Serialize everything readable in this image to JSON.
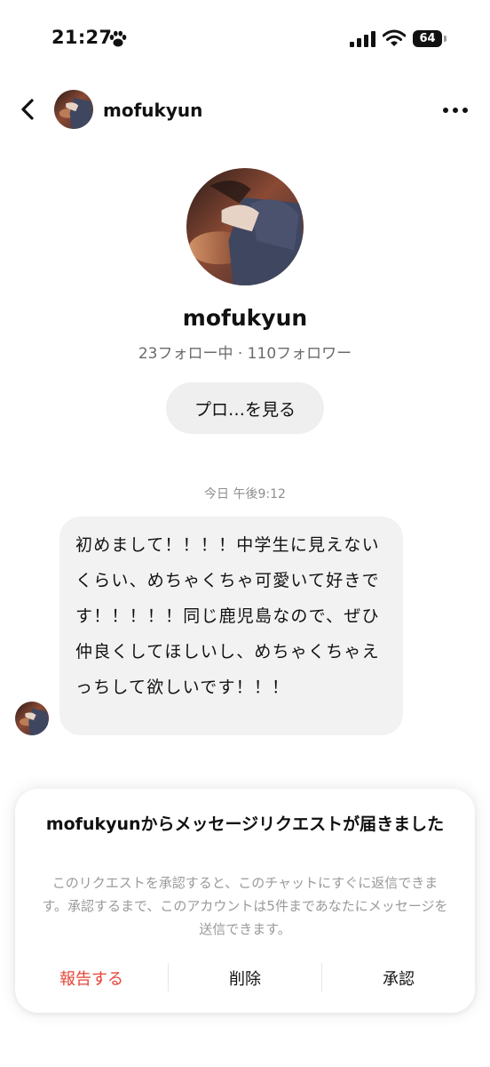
{
  "status_bar": {
    "time": "21:27",
    "battery_level": "64",
    "icons": [
      "paw-icon",
      "signal-icon",
      "wifi-icon",
      "battery-icon"
    ]
  },
  "header": {
    "username": "mofukyun",
    "icons": [
      "back-arrow-icon",
      "more-dots-icon"
    ]
  },
  "profile": {
    "name": "mofukyun",
    "stats": "23フォロー中 · 110フォロワー",
    "view_profile_label": "プロ…を見る"
  },
  "chat": {
    "timestamp": "今日 午後9:12",
    "message": "初めまして！！！！中学生に見えないくらい、めちゃくちゃ可愛いて好きです！！！！！同じ鹿児島なので、ぜひ仲良くしてほしいし、めちゃくちゃえっちして欲しいです！！！"
  },
  "request": {
    "title": "mofukyunからメッセージリクエストが届きました",
    "description": "このリクエストを承認すると、このチャットにすぐに返信できます。承認するまで、このアカウントは5件まであなたにメッセージを送信できます。",
    "report_label": "報告する",
    "delete_label": "削除",
    "accept_label": "承認"
  },
  "colors": {
    "report_red": "#e54437",
    "bubble_gray": "#f2f2f2",
    "muted_text": "#6b6b6b"
  }
}
